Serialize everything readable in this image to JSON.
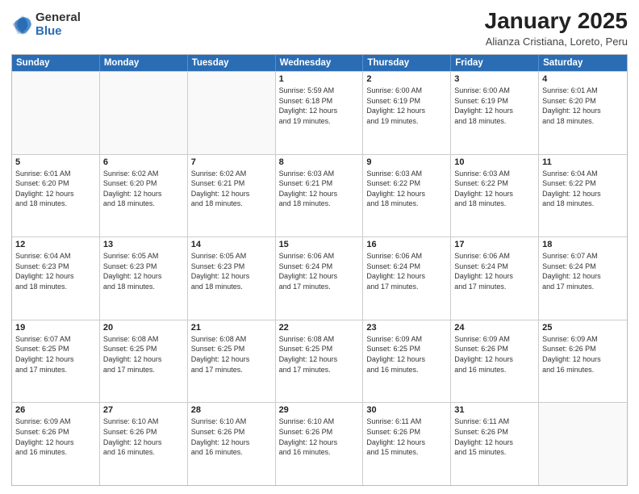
{
  "logo": {
    "general": "General",
    "blue": "Blue"
  },
  "title": "January 2025",
  "subtitle": "Alianza Cristiana, Loreto, Peru",
  "days": [
    "Sunday",
    "Monday",
    "Tuesday",
    "Wednesday",
    "Thursday",
    "Friday",
    "Saturday"
  ],
  "weeks": [
    [
      {
        "day": "",
        "info": ""
      },
      {
        "day": "",
        "info": ""
      },
      {
        "day": "",
        "info": ""
      },
      {
        "day": "1",
        "info": "Sunrise: 5:59 AM\nSunset: 6:18 PM\nDaylight: 12 hours\nand 19 minutes."
      },
      {
        "day": "2",
        "info": "Sunrise: 6:00 AM\nSunset: 6:19 PM\nDaylight: 12 hours\nand 19 minutes."
      },
      {
        "day": "3",
        "info": "Sunrise: 6:00 AM\nSunset: 6:19 PM\nDaylight: 12 hours\nand 18 minutes."
      },
      {
        "day": "4",
        "info": "Sunrise: 6:01 AM\nSunset: 6:20 PM\nDaylight: 12 hours\nand 18 minutes."
      }
    ],
    [
      {
        "day": "5",
        "info": "Sunrise: 6:01 AM\nSunset: 6:20 PM\nDaylight: 12 hours\nand 18 minutes."
      },
      {
        "day": "6",
        "info": "Sunrise: 6:02 AM\nSunset: 6:20 PM\nDaylight: 12 hours\nand 18 minutes."
      },
      {
        "day": "7",
        "info": "Sunrise: 6:02 AM\nSunset: 6:21 PM\nDaylight: 12 hours\nand 18 minutes."
      },
      {
        "day": "8",
        "info": "Sunrise: 6:03 AM\nSunset: 6:21 PM\nDaylight: 12 hours\nand 18 minutes."
      },
      {
        "day": "9",
        "info": "Sunrise: 6:03 AM\nSunset: 6:22 PM\nDaylight: 12 hours\nand 18 minutes."
      },
      {
        "day": "10",
        "info": "Sunrise: 6:03 AM\nSunset: 6:22 PM\nDaylight: 12 hours\nand 18 minutes."
      },
      {
        "day": "11",
        "info": "Sunrise: 6:04 AM\nSunset: 6:22 PM\nDaylight: 12 hours\nand 18 minutes."
      }
    ],
    [
      {
        "day": "12",
        "info": "Sunrise: 6:04 AM\nSunset: 6:23 PM\nDaylight: 12 hours\nand 18 minutes."
      },
      {
        "day": "13",
        "info": "Sunrise: 6:05 AM\nSunset: 6:23 PM\nDaylight: 12 hours\nand 18 minutes."
      },
      {
        "day": "14",
        "info": "Sunrise: 6:05 AM\nSunset: 6:23 PM\nDaylight: 12 hours\nand 18 minutes."
      },
      {
        "day": "15",
        "info": "Sunrise: 6:06 AM\nSunset: 6:24 PM\nDaylight: 12 hours\nand 17 minutes."
      },
      {
        "day": "16",
        "info": "Sunrise: 6:06 AM\nSunset: 6:24 PM\nDaylight: 12 hours\nand 17 minutes."
      },
      {
        "day": "17",
        "info": "Sunrise: 6:06 AM\nSunset: 6:24 PM\nDaylight: 12 hours\nand 17 minutes."
      },
      {
        "day": "18",
        "info": "Sunrise: 6:07 AM\nSunset: 6:24 PM\nDaylight: 12 hours\nand 17 minutes."
      }
    ],
    [
      {
        "day": "19",
        "info": "Sunrise: 6:07 AM\nSunset: 6:25 PM\nDaylight: 12 hours\nand 17 minutes."
      },
      {
        "day": "20",
        "info": "Sunrise: 6:08 AM\nSunset: 6:25 PM\nDaylight: 12 hours\nand 17 minutes."
      },
      {
        "day": "21",
        "info": "Sunrise: 6:08 AM\nSunset: 6:25 PM\nDaylight: 12 hours\nand 17 minutes."
      },
      {
        "day": "22",
        "info": "Sunrise: 6:08 AM\nSunset: 6:25 PM\nDaylight: 12 hours\nand 17 minutes."
      },
      {
        "day": "23",
        "info": "Sunrise: 6:09 AM\nSunset: 6:25 PM\nDaylight: 12 hours\nand 16 minutes."
      },
      {
        "day": "24",
        "info": "Sunrise: 6:09 AM\nSunset: 6:26 PM\nDaylight: 12 hours\nand 16 minutes."
      },
      {
        "day": "25",
        "info": "Sunrise: 6:09 AM\nSunset: 6:26 PM\nDaylight: 12 hours\nand 16 minutes."
      }
    ],
    [
      {
        "day": "26",
        "info": "Sunrise: 6:09 AM\nSunset: 6:26 PM\nDaylight: 12 hours\nand 16 minutes."
      },
      {
        "day": "27",
        "info": "Sunrise: 6:10 AM\nSunset: 6:26 PM\nDaylight: 12 hours\nand 16 minutes."
      },
      {
        "day": "28",
        "info": "Sunrise: 6:10 AM\nSunset: 6:26 PM\nDaylight: 12 hours\nand 16 minutes."
      },
      {
        "day": "29",
        "info": "Sunrise: 6:10 AM\nSunset: 6:26 PM\nDaylight: 12 hours\nand 16 minutes."
      },
      {
        "day": "30",
        "info": "Sunrise: 6:11 AM\nSunset: 6:26 PM\nDaylight: 12 hours\nand 15 minutes."
      },
      {
        "day": "31",
        "info": "Sunrise: 6:11 AM\nSunset: 6:26 PM\nDaylight: 12 hours\nand 15 minutes."
      },
      {
        "day": "",
        "info": ""
      }
    ]
  ]
}
